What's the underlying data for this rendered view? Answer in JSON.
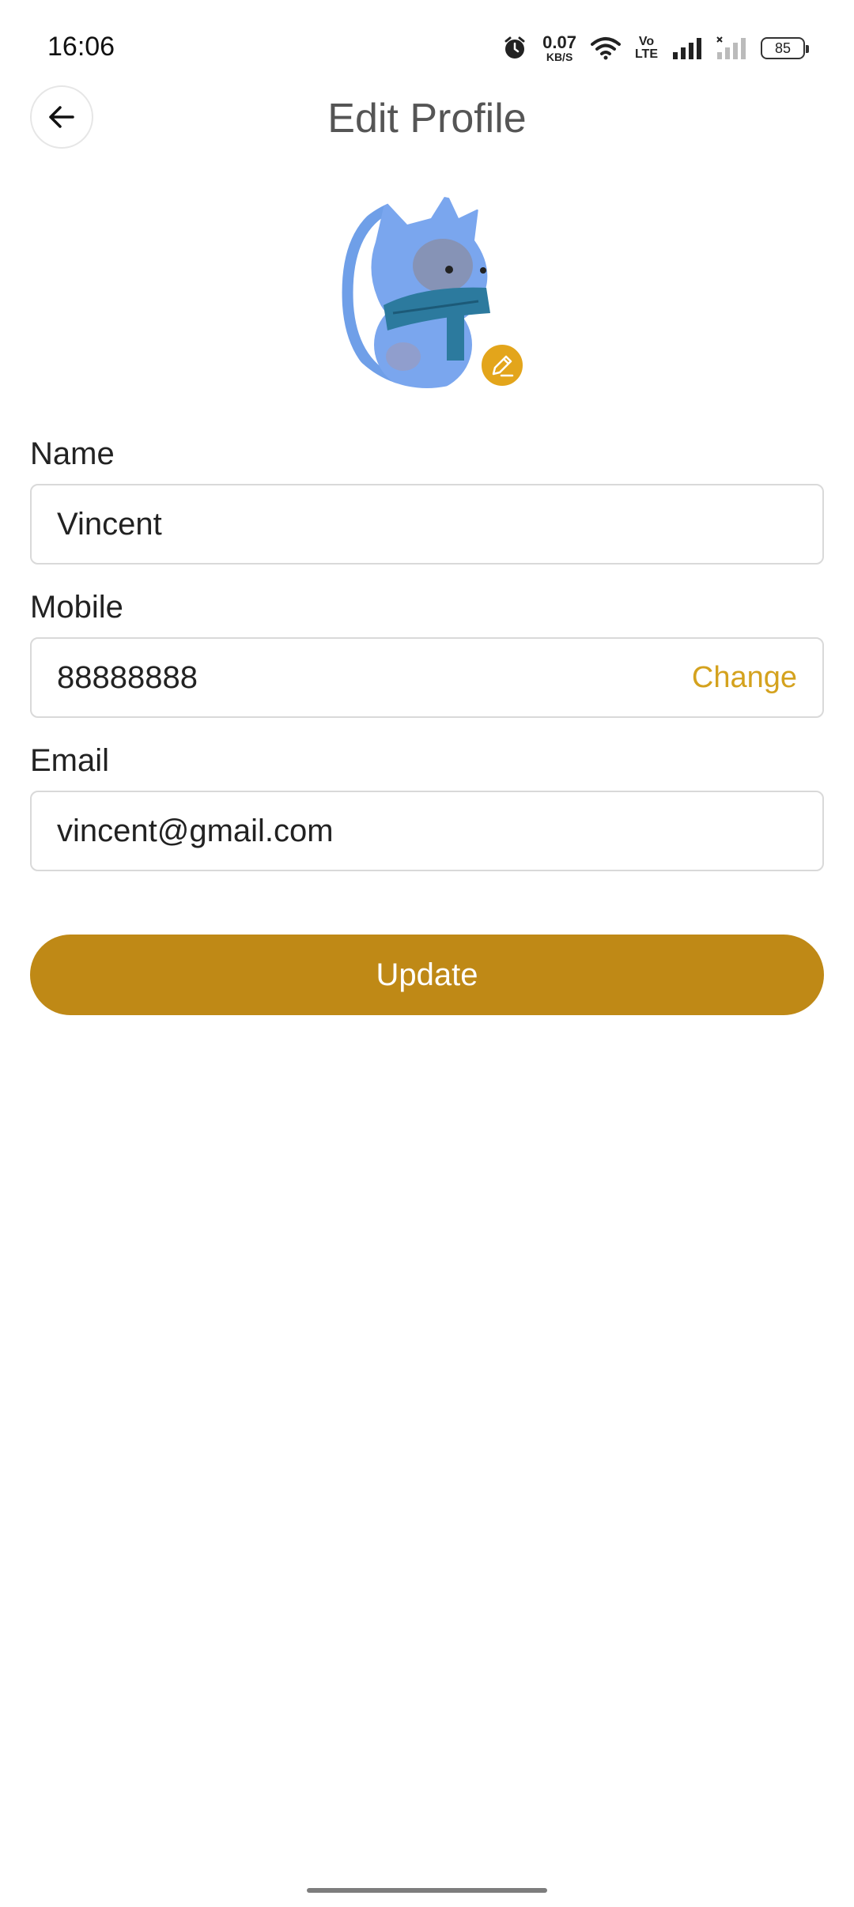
{
  "status_bar": {
    "time": "16:06",
    "net_speed_value": "0.07",
    "net_speed_unit": "KB/S",
    "volte_top": "Vo",
    "volte_bottom": "LTE",
    "battery": "85"
  },
  "header": {
    "title": "Edit Profile"
  },
  "form": {
    "name_label": "Name",
    "name_value": "Vincent",
    "mobile_label": "Mobile",
    "mobile_value": "88888888",
    "change_label": "Change",
    "email_label": "Email",
    "email_value": "vincent@gmail.com"
  },
  "update_label": "Update",
  "colors": {
    "accent_button": "#bf8916",
    "change_link": "#d4a21e",
    "avatar_edit_badge": "#e3a51b",
    "avatar_primary": "#6f9fe8"
  },
  "icons": {
    "back": "arrow-left-icon",
    "avatar_edit": "pencil-icon",
    "alarm": "alarm-icon",
    "wifi": "wifi-icon",
    "signal": "signal-icon",
    "battery": "battery-icon"
  }
}
